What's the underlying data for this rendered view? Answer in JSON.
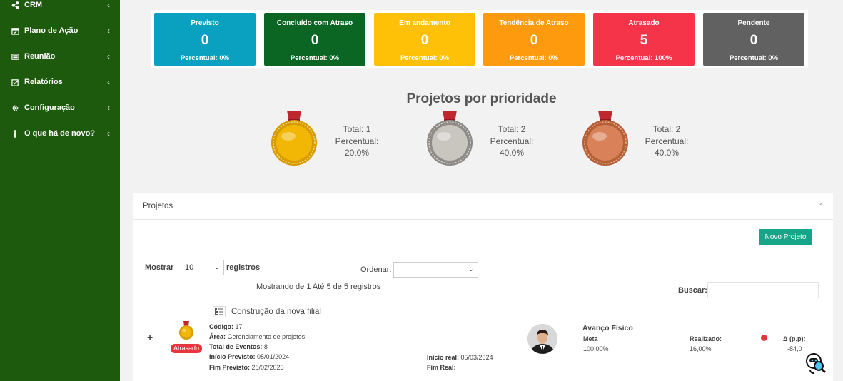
{
  "sidebar": {
    "items": [
      {
        "label": "CRM",
        "icon": "share-icon"
      },
      {
        "label": "Plano de Ação",
        "icon": "calendar-icon"
      },
      {
        "label": "Reunião",
        "icon": "list-alt-icon"
      },
      {
        "label": "Relatórios",
        "icon": "check-square-icon"
      },
      {
        "label": "Configuração",
        "icon": "gear-icon"
      },
      {
        "label": "O que há de novo?",
        "icon": "info-icon"
      }
    ],
    "chevron": "‹"
  },
  "status_cards": [
    {
      "title": "Previsto",
      "value": "0",
      "percent": "Percentual: 0%",
      "color": "#0aa0c0"
    },
    {
      "title": "Concluído com Atraso",
      "value": "0",
      "percent": "Percentual: 0%",
      "color": "#0b6623"
    },
    {
      "title": "Em andamento",
      "value": "0",
      "percent": "Percentual: 0%",
      "color": "#ffc107"
    },
    {
      "title": "Tendência de Atraso",
      "value": "0",
      "percent": "Percentual: 0%",
      "color": "#fd9a0e"
    },
    {
      "title": "Atrasado",
      "value": "5",
      "percent": "Percentual: 100%",
      "color": "#f5344a"
    },
    {
      "title": "Pendente",
      "value": "0",
      "percent": "Percentual: 0%",
      "color": "#616161"
    }
  ],
  "priority": {
    "title": "Projetos por prioridade",
    "medals": [
      {
        "name": "gold",
        "total": "Total: 1",
        "pct_label": "Percentual:",
        "pct": "20.0%",
        "color": "#f2b705"
      },
      {
        "name": "silver",
        "total": "Total: 2",
        "pct_label": "Percentual:",
        "pct": "40.0%",
        "color": "#b8b5b0"
      },
      {
        "name": "bronze",
        "total": "Total: 2",
        "pct_label": "Percentual:",
        "pct": "40.0%",
        "color": "#d9825a"
      }
    ]
  },
  "projects_panel": {
    "title": "Projetos",
    "collapse_icon": "⌃",
    "new_button": "Novo Projeto",
    "show_label": "Mostrar",
    "show_value": "10",
    "records_label": "registros",
    "order_label": "Ordenar:",
    "order_value": "",
    "showing": "Mostrando de 1 Até 5 de 5 registros",
    "search_label": "Buscar:",
    "search_value": ""
  },
  "project": {
    "expand": "+",
    "title": "Construção da nova filial",
    "status": "Atrasado",
    "codigo_label": "Código:",
    "codigo": "17",
    "area_label": "Área:",
    "area": "Gerenciamento de projetos",
    "eventos_label": "Total de Eventos:",
    "eventos": "8",
    "inicio_prev_label": "Início Previsto:",
    "inicio_prev": "05/01/2024",
    "fim_prev_label": "Fim Previsto:",
    "fim_prev": "28/02/2025",
    "inicio_real_label": "Início real:",
    "inicio_real": "05/03/2024",
    "fim_real_label": "Fim Real:",
    "fim_real": "",
    "avanco_label": "Avanço Físico",
    "meta_label": "Meta",
    "meta": "100,00%",
    "realizado_label": "Realizado:",
    "realizado": "16,00%",
    "delta_label": "Δ (p.p):",
    "delta": "-84,0"
  }
}
